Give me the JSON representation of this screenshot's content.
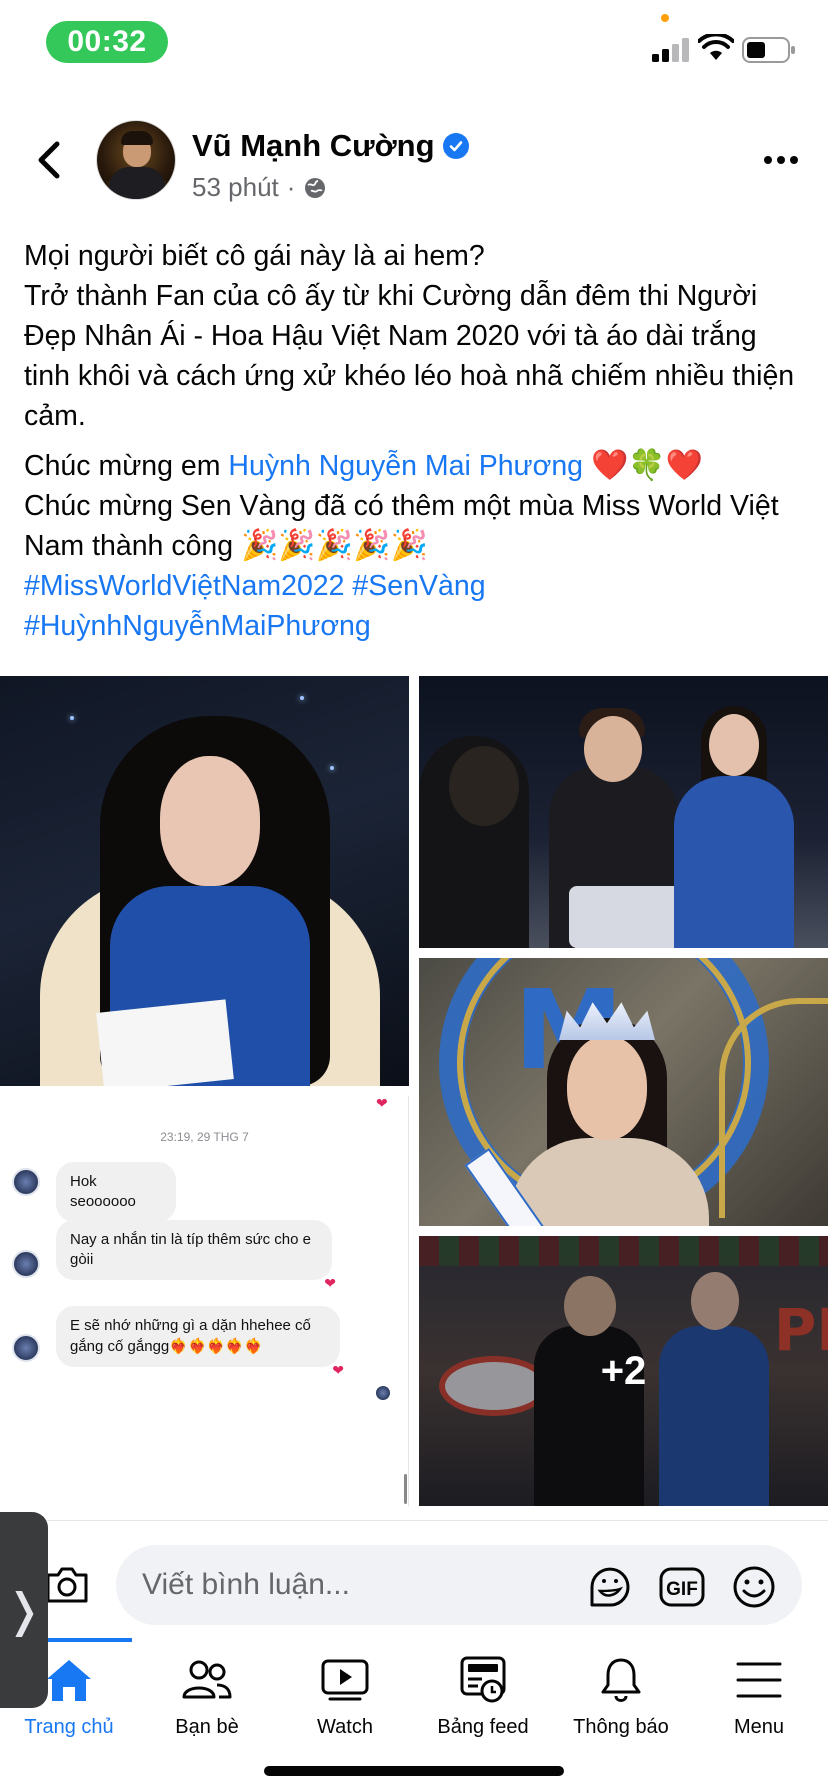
{
  "status_bar": {
    "time": "00:32"
  },
  "post": {
    "author_name": "Vũ Mạnh Cường",
    "timestamp": "53 phút",
    "separator": "·",
    "paragraph1_lines": [
      "Mọi người biết cô gái này là ai hem?",
      "Trở thành Fan của cô ấy từ khi Cường dẫn đêm thi Người Đẹp Nhân Ái - Hoa Hậu Việt Nam 2020 với tà áo dài trắng tinh khôi và cách ứng xử khéo léo hoà nhã chiếm nhiều thiện cảm."
    ],
    "congrats_prefix": "Chúc mừng em ",
    "mention": "Huỳnh Nguyễn Mai Phương",
    "congrats_emojis": "❤️🍀❤️",
    "congrats2": "Chúc mừng Sen Vàng đã có thêm một mùa Miss World Việt Nam thành công",
    "party_emojis": "🎉🎉🎉🎉🎉",
    "hashtag1": "#MissWorldViệtNam2022",
    "hashtag2": "#SenVàng",
    "hashtag3": "#HuỳnhNguyễnMaiPhương"
  },
  "photos": {
    "more_count": "+2",
    "stage_letters": "PI",
    "crown_letter": "M"
  },
  "chat_screenshot": {
    "date": "23:19, 29 THG 7",
    "messages": [
      {
        "text": "Hok seoooooo",
        "reaction": "❤"
      },
      {
        "text": "Nay a nhắn tin là típ thêm sức cho e gòii",
        "reaction": "❤"
      },
      {
        "text": "E sẽ nhớ những gì a dặn hhehee cố gắng cố gắngg",
        "emojis": "❤‍🔥❤‍🔥❤‍🔥❤‍🔥❤‍🔥",
        "reaction": "❤"
      }
    ]
  },
  "comment_bar": {
    "placeholder": "Viết bình luận..."
  },
  "bottom_nav": {
    "items": [
      {
        "label": "Trang chủ",
        "icon": "home-icon",
        "active": true
      },
      {
        "label": "Bạn bè",
        "icon": "friends-icon",
        "active": false
      },
      {
        "label": "Watch",
        "icon": "watch-icon",
        "active": false
      },
      {
        "label": "Bảng feed",
        "icon": "feed-icon",
        "active": false
      },
      {
        "label": "Thông báo",
        "icon": "bell-icon",
        "active": false
      },
      {
        "label": "Menu",
        "icon": "menu-icon",
        "active": false
      }
    ]
  },
  "colors": {
    "accent": "#1877f2",
    "time_pill": "#34c759",
    "text": "#050505",
    "secondary": "#65676b"
  }
}
